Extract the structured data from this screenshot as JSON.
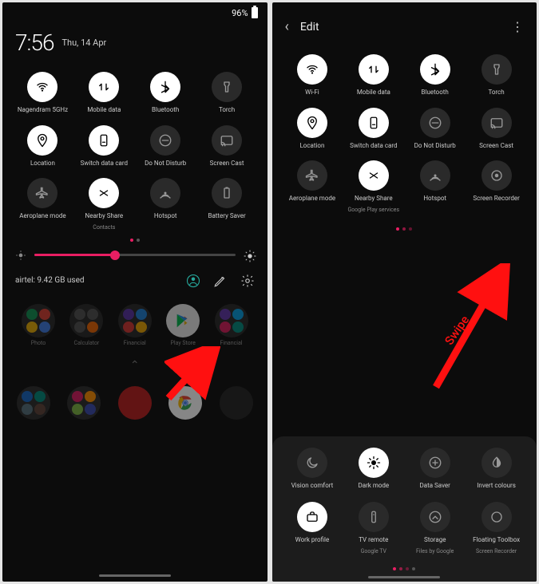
{
  "left": {
    "status": {
      "battery_pct": "96%"
    },
    "clock": {
      "time": "7:56",
      "date": "Thu, 14 Apr"
    },
    "tiles": [
      {
        "label": "Nagendram 5GHz",
        "icon": "wifi",
        "state": "on"
      },
      {
        "label": "Mobile data",
        "icon": "data",
        "state": "on"
      },
      {
        "label": "Bluetooth",
        "icon": "bluetooth",
        "state": "on"
      },
      {
        "label": "Torch",
        "icon": "torch",
        "state": "off"
      },
      {
        "label": "Location",
        "icon": "location",
        "state": "on"
      },
      {
        "label": "Switch data card",
        "icon": "sim",
        "state": "on"
      },
      {
        "label": "Do Not Disturb",
        "icon": "dnd",
        "state": "off"
      },
      {
        "label": "Screen Cast",
        "icon": "cast",
        "state": "off"
      },
      {
        "label": "Aeroplane mode",
        "icon": "airplane",
        "state": "off"
      },
      {
        "label": "Nearby Share",
        "sublabel": "Contacts",
        "icon": "nearby",
        "state": "on"
      },
      {
        "label": "Hotspot",
        "icon": "hotspot",
        "state": "off"
      },
      {
        "label": "Battery Saver",
        "icon": "battery-saver",
        "state": "off"
      }
    ],
    "brightness_pct": 40,
    "footer": {
      "data_usage": "airtel: 9.42 GB used"
    },
    "apps_row1": [
      {
        "label": "Photo",
        "type": "folder",
        "colors": [
          "#0f9d58",
          "#ea4335",
          "#fbbc05",
          "#4285f4"
        ]
      },
      {
        "label": "Calculator",
        "type": "folder",
        "colors": [
          "#555",
          "#555",
          "#555",
          "#ff6d00"
        ]
      },
      {
        "label": "Financial",
        "type": "folder",
        "colors": [
          "#5e35b1",
          "#1e88e5",
          "#e53935",
          "#ffb300"
        ]
      },
      {
        "label": "Play Store",
        "type": "app",
        "icon": "play-store"
      },
      {
        "label": "Financial",
        "type": "folder",
        "colors": [
          "#673ab7",
          "#03a9f4",
          "#e91e63",
          "#009688"
        ]
      }
    ],
    "dock": [
      {
        "type": "folder",
        "colors": [
          "#1565c0",
          "#00897b",
          "#546e7a",
          "#5d4037"
        ]
      },
      {
        "type": "folder",
        "colors": [
          "#d81b60",
          "#fb8c00",
          "#7cb342",
          "#3949ab"
        ]
      },
      {
        "type": "app",
        "color": "#b71c1c"
      },
      {
        "type": "app",
        "icon": "chrome"
      },
      {
        "type": "app",
        "color": "#212121"
      }
    ]
  },
  "right": {
    "header": {
      "title": "Edit"
    },
    "tiles_top": [
      {
        "label": "Wi-Fi",
        "icon": "wifi",
        "state": "on"
      },
      {
        "label": "Mobile data",
        "icon": "data",
        "state": "on"
      },
      {
        "label": "Bluetooth",
        "icon": "bluetooth",
        "state": "on"
      },
      {
        "label": "Torch",
        "icon": "torch",
        "state": "off"
      },
      {
        "label": "Location",
        "icon": "location",
        "state": "on"
      },
      {
        "label": "Switch data card",
        "icon": "sim",
        "state": "on"
      },
      {
        "label": "Do Not Disturb",
        "icon": "dnd",
        "state": "off"
      },
      {
        "label": "Screen Cast",
        "icon": "cast",
        "state": "off"
      },
      {
        "label": "Aeroplane mode",
        "icon": "airplane",
        "state": "off"
      },
      {
        "label": "Nearby Share",
        "sublabel": "Google Play services",
        "icon": "nearby",
        "state": "on"
      },
      {
        "label": "Hotspot",
        "icon": "hotspot",
        "state": "off"
      },
      {
        "label": "Screen Recorder",
        "icon": "record",
        "state": "off"
      }
    ],
    "tiles_bottom": [
      {
        "label": "Vision comfort",
        "icon": "moon",
        "state": "off"
      },
      {
        "label": "Dark mode",
        "icon": "dark",
        "state": "on"
      },
      {
        "label": "Data Saver",
        "icon": "datasaver",
        "state": "off"
      },
      {
        "label": "Invert colours",
        "icon": "invert",
        "state": "off"
      },
      {
        "label": "Work profile",
        "icon": "work",
        "state": "on"
      },
      {
        "label": "TV remote",
        "sublabel": "Google TV",
        "icon": "remote",
        "state": "off"
      },
      {
        "label": "Storage",
        "sublabel": "Files by Google",
        "icon": "storage",
        "state": "off"
      },
      {
        "label": "Floating Toolbox",
        "sublabel": "Screen Recorder",
        "icon": "circle",
        "state": "off"
      }
    ],
    "swipe_label": "Swipe"
  }
}
